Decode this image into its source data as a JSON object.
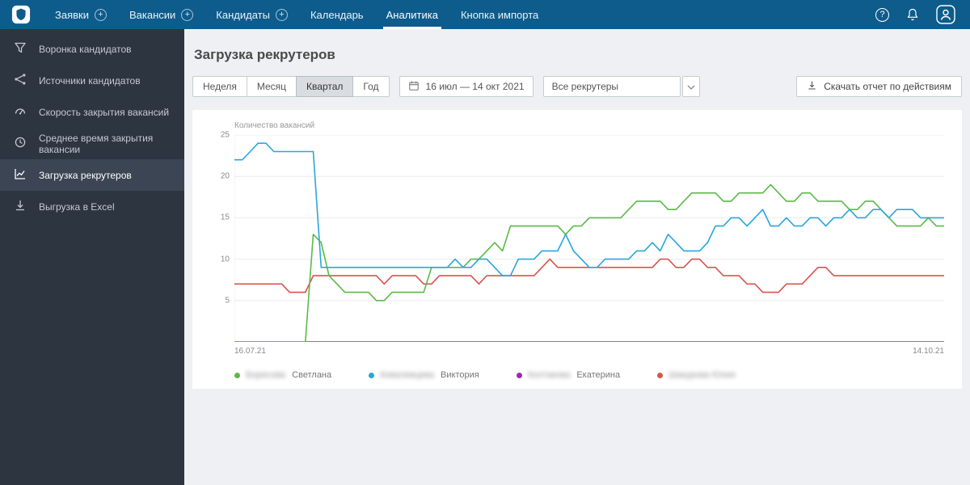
{
  "topbar": {
    "menu": [
      {
        "label": "Заявки",
        "has_plus": true
      },
      {
        "label": "Вакансии",
        "has_plus": true
      },
      {
        "label": "Кандидаты",
        "has_plus": true
      },
      {
        "label": "Календарь",
        "has_plus": false
      },
      {
        "label": "Аналитика",
        "has_plus": false
      },
      {
        "label": "Кнопка импорта",
        "has_plus": false
      }
    ],
    "active_item": "Аналитика",
    "help_glyph": "?"
  },
  "sidebar": {
    "items": [
      {
        "label": "Воронка кандидатов"
      },
      {
        "label": "Источники кандидатов"
      },
      {
        "label": "Скорость закрытия вакансий"
      },
      {
        "label": "Среднее время закрытия вакансии"
      },
      {
        "label": "Загрузка рекрутеров"
      },
      {
        "label": "Выгрузка в Excel"
      }
    ],
    "active_item": "Загрузка рекрутеров"
  },
  "page": {
    "title": "Загрузка рекрутеров"
  },
  "toolbar": {
    "periods": [
      "Неделя",
      "Месяц",
      "Квартал",
      "Год"
    ],
    "active_period": "Квартал",
    "date_range": "16 июл — 14 окт 2021",
    "recruiter_filter": "Все рекрутеры",
    "download_label": "Скачать отчет по действиям"
  },
  "chart_data": {
    "type": "line",
    "title": "Количество вакансий",
    "ylabel": "Количество вакансий",
    "ylim": [
      0,
      25
    ],
    "yticks": [
      5,
      10,
      15,
      20,
      25
    ],
    "x_start": "16.07.21",
    "x_end": "14.10.21",
    "grid": "horizontal",
    "legend_position": "bottom",
    "series": [
      {
        "name": "Колтакова Екатерина",
        "color": "#9c27b0",
        "values": [
          0,
          0,
          0,
          0,
          0,
          0,
          0,
          0,
          0,
          0,
          0,
          0,
          0,
          0,
          0,
          0,
          0,
          0,
          0,
          0,
          0,
          0,
          0,
          0,
          0,
          0,
          0,
          0,
          0,
          0,
          0,
          0,
          0,
          0,
          0,
          0,
          0,
          0,
          0,
          0,
          0,
          0,
          0,
          0,
          0,
          0,
          0,
          0,
          0,
          0,
          0,
          0,
          0,
          0,
          0,
          0,
          0,
          0,
          0,
          0,
          0,
          0,
          0,
          0,
          0,
          0,
          0,
          0,
          0,
          0,
          0,
          0,
          0,
          0,
          0,
          0,
          0,
          0,
          0,
          0,
          0,
          0,
          0,
          0,
          0,
          0,
          0,
          0,
          0,
          0,
          0
        ]
      },
      {
        "name": "Шакурова Юлия",
        "color": "#d9534f",
        "values": [
          7,
          7,
          7,
          7,
          7,
          7,
          7,
          6,
          6,
          6,
          8,
          8,
          8,
          8,
          8,
          8,
          8,
          8,
          8,
          7,
          8,
          8,
          8,
          8,
          7,
          7,
          8,
          8,
          8,
          8,
          8,
          7,
          8,
          8,
          8,
          8,
          8,
          8,
          8,
          9,
          10,
          9,
          9,
          9,
          9,
          9,
          9,
          9,
          9,
          9,
          9,
          9,
          9,
          9,
          10,
          10,
          9,
          9,
          10,
          10,
          9,
          9,
          8,
          8,
          8,
          7,
          7,
          6,
          6,
          6,
          7,
          7,
          7,
          8,
          9,
          9,
          8,
          8,
          8,
          8,
          8,
          8,
          8,
          8,
          8,
          8,
          8,
          8,
          8,
          8,
          8
        ]
      },
      {
        "name": "Борисова Светлана",
        "color": "#5aba47",
        "values": [
          0,
          0,
          0,
          0,
          0,
          0,
          0,
          0,
          0,
          0,
          13,
          12,
          8,
          7,
          6,
          6,
          6,
          6,
          5,
          5,
          6,
          6,
          6,
          6,
          6,
          9,
          9,
          9,
          9,
          9,
          10,
          10,
          11,
          12,
          11,
          14,
          14,
          14,
          14,
          14,
          14,
          14,
          13,
          14,
          14,
          15,
          15,
          15,
          15,
          15,
          16,
          17,
          17,
          17,
          17,
          16,
          16,
          17,
          18,
          18,
          18,
          18,
          17,
          17,
          18,
          18,
          18,
          18,
          19,
          18,
          17,
          17,
          18,
          18,
          17,
          17,
          17,
          17,
          16,
          16,
          17,
          17,
          16,
          15,
          14,
          14,
          14,
          14,
          15,
          14,
          14
        ]
      },
      {
        "name": "Ковалевцева Виктория",
        "color": "#29a6dc",
        "values": [
          22,
          22,
          23,
          24,
          24,
          23,
          23,
          23,
          23,
          23,
          23,
          9,
          9,
          9,
          9,
          9,
          9,
          9,
          9,
          9,
          9,
          9,
          9,
          9,
          9,
          9,
          9,
          9,
          10,
          9,
          9,
          10,
          10,
          9,
          8,
          8,
          10,
          10,
          10,
          11,
          11,
          11,
          13,
          11,
          10,
          9,
          9,
          10,
          10,
          10,
          10,
          11,
          11,
          12,
          11,
          13,
          12,
          11,
          11,
          11,
          12,
          14,
          14,
          15,
          15,
          14,
          15,
          16,
          14,
          14,
          15,
          14,
          14,
          15,
          15,
          14,
          15,
          15,
          16,
          15,
          15,
          16,
          16,
          15,
          16,
          16,
          16,
          15,
          15,
          15,
          15
        ]
      }
    ],
    "legend": [
      {
        "color": "#5aba47",
        "name_blurred": "Борисова",
        "name_visible": "Светлана"
      },
      {
        "color": "#29a6dc",
        "name_blurred": "Ковалевцева",
        "name_visible": "Виктория"
      },
      {
        "color": "#9c27b0",
        "name_blurred": "Колтакова",
        "name_visible": "Екатерина"
      },
      {
        "color": "#d9534f",
        "name_blurred": "Шакурова Юлия",
        "name_visible": ""
      }
    ]
  }
}
